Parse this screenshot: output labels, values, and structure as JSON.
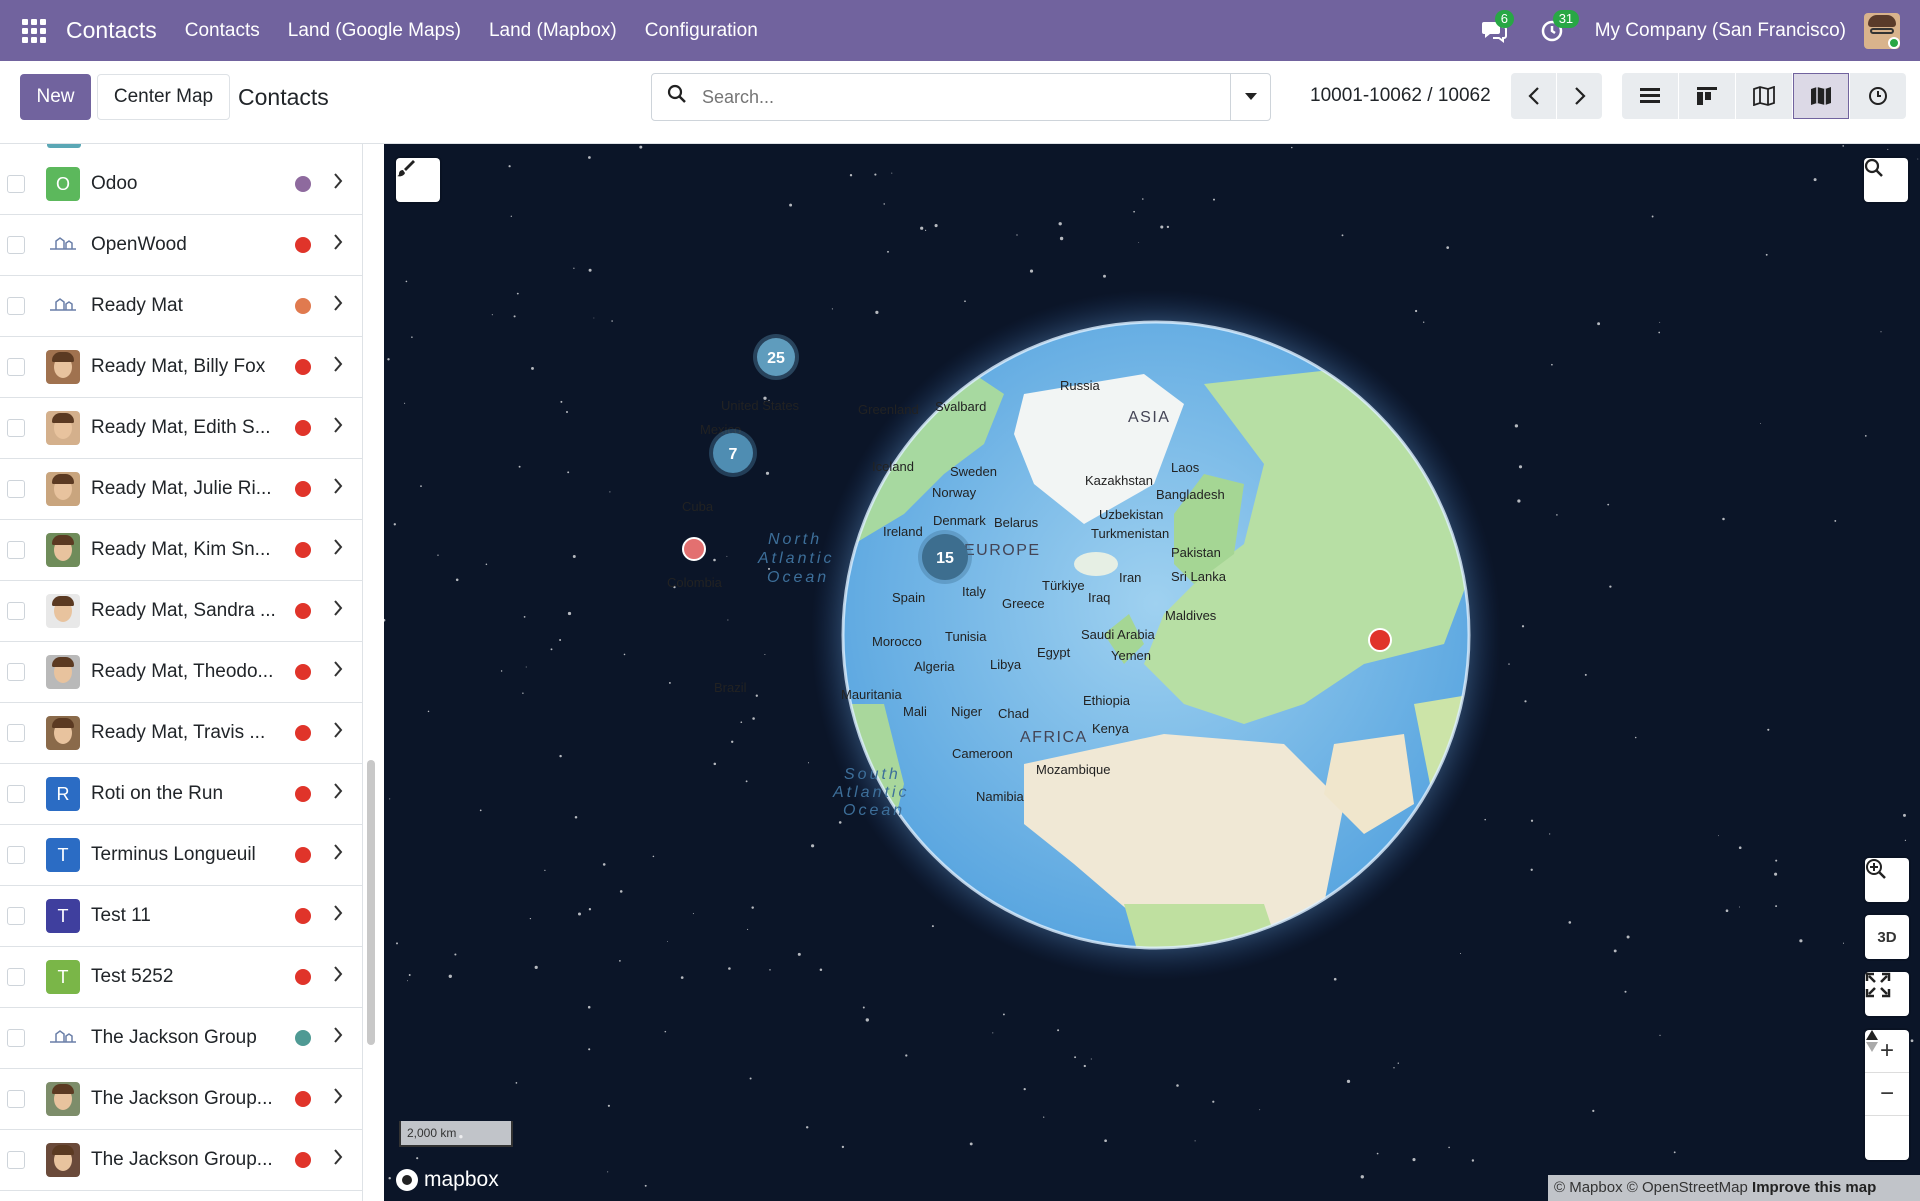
{
  "topbar": {
    "app_name": "Contacts",
    "menu": [
      "Contacts",
      "Land (Google Maps)",
      "Land (Mapbox)",
      "Configuration"
    ],
    "messages_badge": "6",
    "activities_badge": "31",
    "company": "My Company (San Francisco)"
  },
  "control": {
    "new_label": "New",
    "center_map_label": "Center Map",
    "title": "Contacts",
    "search_placeholder": "Search...",
    "pager": "10001-10062 / 10062"
  },
  "contacts": [
    {
      "name": "Odoo",
      "avatar": "letter",
      "letter": "O",
      "avatar_color": "#5cb85c",
      "dot_color": "#8e6a9e"
    },
    {
      "name": "OpenWood",
      "avatar": "logo",
      "letter": "",
      "avatar_color": "#ffffff",
      "dot_color": "#e0342a"
    },
    {
      "name": "Ready Mat",
      "avatar": "logo",
      "letter": "",
      "avatar_color": "#ffffff",
      "dot_color": "#e07a4f"
    },
    {
      "name": "Ready Mat, Billy Fox",
      "avatar": "photo",
      "letter": "",
      "avatar_color": "#a0724f",
      "dot_color": "#e0342a"
    },
    {
      "name": "Ready Mat, Edith S...",
      "avatar": "photo",
      "letter": "",
      "avatar_color": "#d4b08c",
      "dot_color": "#e0342a"
    },
    {
      "name": "Ready Mat, Julie Ri...",
      "avatar": "photo",
      "letter": "",
      "avatar_color": "#c9a57e",
      "dot_color": "#e0342a"
    },
    {
      "name": "Ready Mat, Kim Sn...",
      "avatar": "photo",
      "letter": "",
      "avatar_color": "#6f8c5a",
      "dot_color": "#e0342a"
    },
    {
      "name": "Ready Mat, Sandra ...",
      "avatar": "photo",
      "letter": "",
      "avatar_color": "#e8e8e8",
      "dot_color": "#e0342a"
    },
    {
      "name": "Ready Mat, Theodo...",
      "avatar": "photo",
      "letter": "",
      "avatar_color": "#b9b9b9",
      "dot_color": "#e0342a"
    },
    {
      "name": "Ready Mat, Travis ...",
      "avatar": "photo",
      "letter": "",
      "avatar_color": "#8a6a4a",
      "dot_color": "#e0342a"
    },
    {
      "name": "Roti on the Run",
      "avatar": "letter",
      "letter": "R",
      "avatar_color": "#2b6cc4",
      "dot_color": "#e0342a"
    },
    {
      "name": "Terminus Longueuil",
      "avatar": "letter",
      "letter": "T",
      "avatar_color": "#2b6cc4",
      "dot_color": "#e0342a"
    },
    {
      "name": "Test 11",
      "avatar": "letter",
      "letter": "T",
      "avatar_color": "#3f3f9e",
      "dot_color": "#e0342a"
    },
    {
      "name": "Test 5252",
      "avatar": "letter",
      "letter": "T",
      "avatar_color": "#7ab648",
      "dot_color": "#e0342a"
    },
    {
      "name": "The Jackson Group",
      "avatar": "logo",
      "letter": "",
      "avatar_color": "#ffffff",
      "dot_color": "#4f9a94"
    },
    {
      "name": "The Jackson Group...",
      "avatar": "photo",
      "letter": "",
      "avatar_color": "#7d8d6a",
      "dot_color": "#e0342a"
    },
    {
      "name": "The Jackson Group...",
      "avatar": "photo",
      "letter": "",
      "avatar_color": "#6a4a3a",
      "dot_color": "#e0342a"
    }
  ],
  "map": {
    "clusters": [
      "25",
      "7",
      "15"
    ],
    "labels": [
      "Russia",
      "ASIA",
      "United States",
      "Greenland",
      "Svalbard",
      "Mexico",
      "Iceland",
      "Sweden",
      "Laos",
      "Kazakhstan",
      "Norway",
      "Bangladesh",
      "Cuba",
      "Denmark",
      "Belarus",
      "Uzbekistan",
      "Ireland",
      "Turkmenistan",
      "North",
      "Atlantic",
      "Ocean",
      "EUROPE",
      "Pakistan",
      "Colombia",
      "Iran",
      "Sri Lanka",
      "Türkiye",
      "Spain",
      "Italy",
      "Iraq",
      "Greece",
      "Maldives",
      "Morocco",
      "Tunisia",
      "Saudi Arabia",
      "Egypt",
      "Algeria",
      "Libya",
      "Yemen",
      "Brazil",
      "Mauritania",
      "Ethiopia",
      "Mali",
      "Niger",
      "Chad",
      "Kenya",
      "AFRICA",
      "Cameroon",
      "South",
      "Atlantic",
      "Ocean",
      "Mozambique",
      "Namibia"
    ],
    "scale": "2,000 km",
    "logo": "mapbox",
    "attribution": "© Mapbox © OpenStreetMap",
    "attribution_link": "Improve this map",
    "btn_3d": "3D"
  },
  "colors": {
    "brand": "#71639e",
    "marker_red": "#e0342a",
    "cluster": "#3d6e8f"
  }
}
